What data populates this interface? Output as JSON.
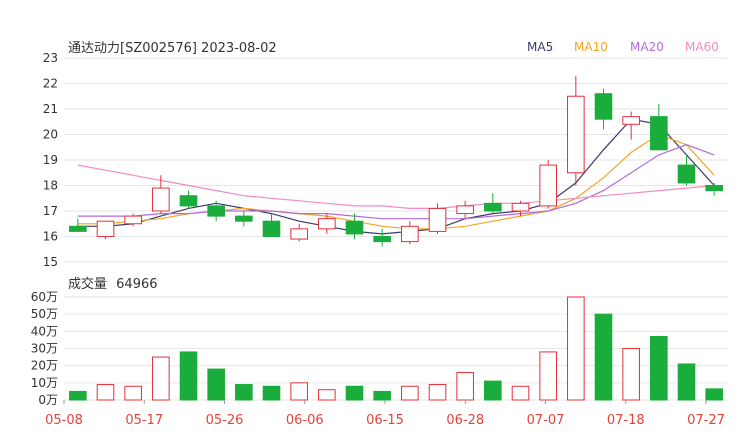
{
  "header": {
    "title": "通达动力[SZ002576] 2023-08-02"
  },
  "legend": [
    {
      "label": "MA5",
      "color": "#3b3b6b"
    },
    {
      "label": "MA10",
      "color": "#f5a623"
    },
    {
      "label": "MA20",
      "color": "#b26cd9"
    },
    {
      "label": "MA60",
      "color": "#f28cc0"
    }
  ],
  "volume_header": {
    "label": "成交量",
    "value": "64966"
  },
  "colors": {
    "up": "#e8303a",
    "down": "#1aad3c",
    "grid": "#e6e6e6"
  },
  "chart_data": [
    {
      "type": "candlestick",
      "title": "通达动力[SZ002576] 2023-08-02",
      "ylim": [
        15,
        23
      ],
      "y_ticks": [
        15,
        16,
        17,
        18,
        19,
        20,
        21,
        22,
        23
      ],
      "x_tick_labels": [
        "05-08",
        "05-17",
        "05-26",
        "06-06",
        "06-15",
        "06-28",
        "07-07",
        "07-18",
        "07-27"
      ],
      "x": [
        "05-08",
        "05-10",
        "05-12",
        "05-15",
        "05-17",
        "05-19",
        "05-23",
        "05-25",
        "05-29",
        "05-31",
        "06-02",
        "06-06",
        "06-08",
        "06-12",
        "06-15",
        "06-19",
        "06-26",
        "06-28",
        "06-30",
        "07-05",
        "07-07",
        "07-12",
        "07-18",
        "07-27"
      ],
      "open": [
        16.4,
        16.0,
        16.5,
        17.0,
        17.6,
        17.2,
        16.8,
        16.6,
        15.9,
        16.3,
        16.6,
        16.0,
        15.8,
        16.2,
        16.9,
        17.3,
        17.0,
        17.2,
        18.5,
        21.6,
        20.4,
        20.7,
        18.8,
        18.0
      ],
      "high": [
        16.7,
        16.6,
        16.9,
        18.4,
        17.8,
        17.4,
        17.0,
        16.9,
        16.5,
        16.9,
        16.9,
        16.3,
        16.6,
        17.3,
        17.4,
        17.7,
        17.4,
        19.0,
        22.3,
        21.8,
        20.9,
        21.2,
        19.2,
        18.1
      ],
      "low": [
        16.2,
        15.9,
        16.4,
        16.9,
        17.1,
        16.6,
        16.4,
        16.0,
        15.8,
        16.1,
        15.9,
        15.6,
        15.7,
        16.1,
        16.7,
        16.9,
        16.8,
        17.1,
        18.0,
        20.2,
        19.8,
        20.0,
        18.0,
        17.6
      ],
      "close": [
        16.2,
        16.6,
        16.8,
        17.9,
        17.2,
        16.8,
        16.6,
        16.0,
        16.3,
        16.7,
        16.1,
        15.8,
        16.4,
        17.1,
        17.2,
        17.0,
        17.3,
        18.8,
        21.5,
        20.6,
        20.7,
        19.4,
        18.1,
        17.8
      ],
      "series": [
        {
          "name": "MA5",
          "values": [
            16.4,
            16.4,
            16.5,
            16.8,
            17.1,
            17.3,
            17.1,
            16.9,
            16.6,
            16.4,
            16.2,
            16.1,
            16.2,
            16.3,
            16.7,
            16.9,
            17.0,
            17.3,
            18.1,
            19.4,
            20.6,
            20.4,
            19.2,
            18.0
          ]
        },
        {
          "name": "MA10",
          "values": [
            16.5,
            16.5,
            16.6,
            16.7,
            16.9,
            17.0,
            17.1,
            17.0,
            16.9,
            16.8,
            16.6,
            16.4,
            16.3,
            16.3,
            16.4,
            16.6,
            16.8,
            17.0,
            17.5,
            18.3,
            19.3,
            20.0,
            19.6,
            18.4
          ]
        },
        {
          "name": "MA20",
          "values": [
            16.8,
            16.8,
            16.8,
            16.9,
            16.9,
            17.0,
            17.0,
            17.0,
            16.9,
            16.9,
            16.8,
            16.7,
            16.7,
            16.7,
            16.7,
            16.8,
            16.9,
            17.0,
            17.3,
            17.8,
            18.5,
            19.2,
            19.6,
            19.2
          ]
        },
        {
          "name": "MA60",
          "values": [
            18.8,
            18.6,
            18.4,
            18.2,
            18.0,
            17.8,
            17.6,
            17.5,
            17.4,
            17.3,
            17.2,
            17.2,
            17.1,
            17.1,
            17.2,
            17.3,
            17.3,
            17.4,
            17.5,
            17.6,
            17.7,
            17.8,
            17.9,
            18.0
          ]
        }
      ]
    },
    {
      "type": "bar",
      "title": "成交量 64966",
      "ylim": [
        0,
        60
      ],
      "y_tick_labels": [
        "0万",
        "10万",
        "20万",
        "30万",
        "40万",
        "50万",
        "60万"
      ],
      "y_ticks": [
        0,
        10,
        20,
        30,
        40,
        50,
        60
      ],
      "x": [
        "05-08",
        "05-10",
        "05-12",
        "05-15",
        "05-17",
        "05-19",
        "05-23",
        "05-25",
        "05-29",
        "05-31",
        "06-02",
        "06-06",
        "06-08",
        "06-12",
        "06-15",
        "06-19",
        "06-26",
        "06-28",
        "06-30",
        "07-05",
        "07-07",
        "07-12",
        "07-18",
        "07-27"
      ],
      "values": [
        5,
        9,
        8,
        25,
        28,
        18,
        9,
        8,
        10,
        6,
        8,
        5,
        8,
        9,
        16,
        11,
        8,
        28,
        60,
        50,
        30,
        37,
        21,
        6.5
      ]
    }
  ]
}
